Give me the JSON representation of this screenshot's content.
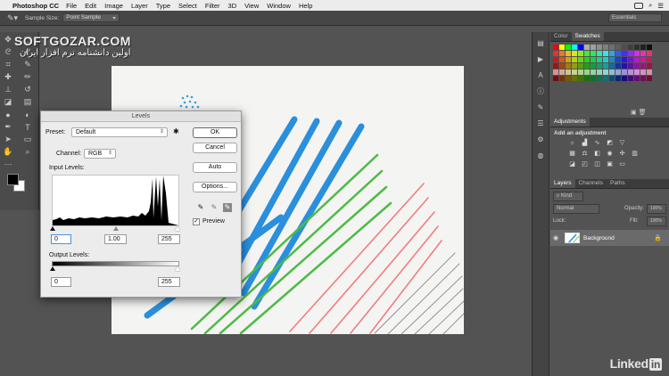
{
  "menubar": {
    "app_name": "Photoshop CC",
    "items": [
      "File",
      "Edit",
      "Image",
      "Layer",
      "Type",
      "Select",
      "Filter",
      "3D",
      "View",
      "Window",
      "Help"
    ]
  },
  "options_bar": {
    "sample_size_label": "Sample Size:",
    "sample_size_value": "Point Sample",
    "workspace": "Essentials"
  },
  "watermark": {
    "line1": "SOFTGOZAR.COM",
    "line2": "اولین دانشنامه نرم افزار ایران"
  },
  "levels_dialog": {
    "title": "Levels",
    "preset_label": "Preset:",
    "preset_value": "Default",
    "channel_label": "Channel:",
    "channel_value": "RGB",
    "input_levels_label": "Input Levels:",
    "input_black": "0",
    "input_gamma": "1.00",
    "input_white": "255",
    "output_levels_label": "Output Levels:",
    "output_black": "0",
    "output_white": "255",
    "ok_label": "OK",
    "cancel_label": "Cancel",
    "auto_label": "Auto",
    "options_label": "Options...",
    "preview_label": "Preview",
    "preview_checked": true
  },
  "panels": {
    "color_tab": "Color",
    "swatches_tab": "Swatches",
    "adjustments_tab": "Adjustments",
    "add_adjustment": "Add an adjustment",
    "layers_tab": "Layers",
    "channels_tab": "Channels",
    "paths_tab": "Paths",
    "kind_filter": "Kind",
    "blend_mode": "Normal",
    "opacity_label": "Opacity:",
    "opacity_value": "100%",
    "lock_label": "Lock:",
    "fill_label": "Fill:",
    "fill_value": "100%",
    "layer_name": "Background"
  },
  "brand": {
    "linkedin_text": "Linked",
    "linkedin_in": "in"
  }
}
